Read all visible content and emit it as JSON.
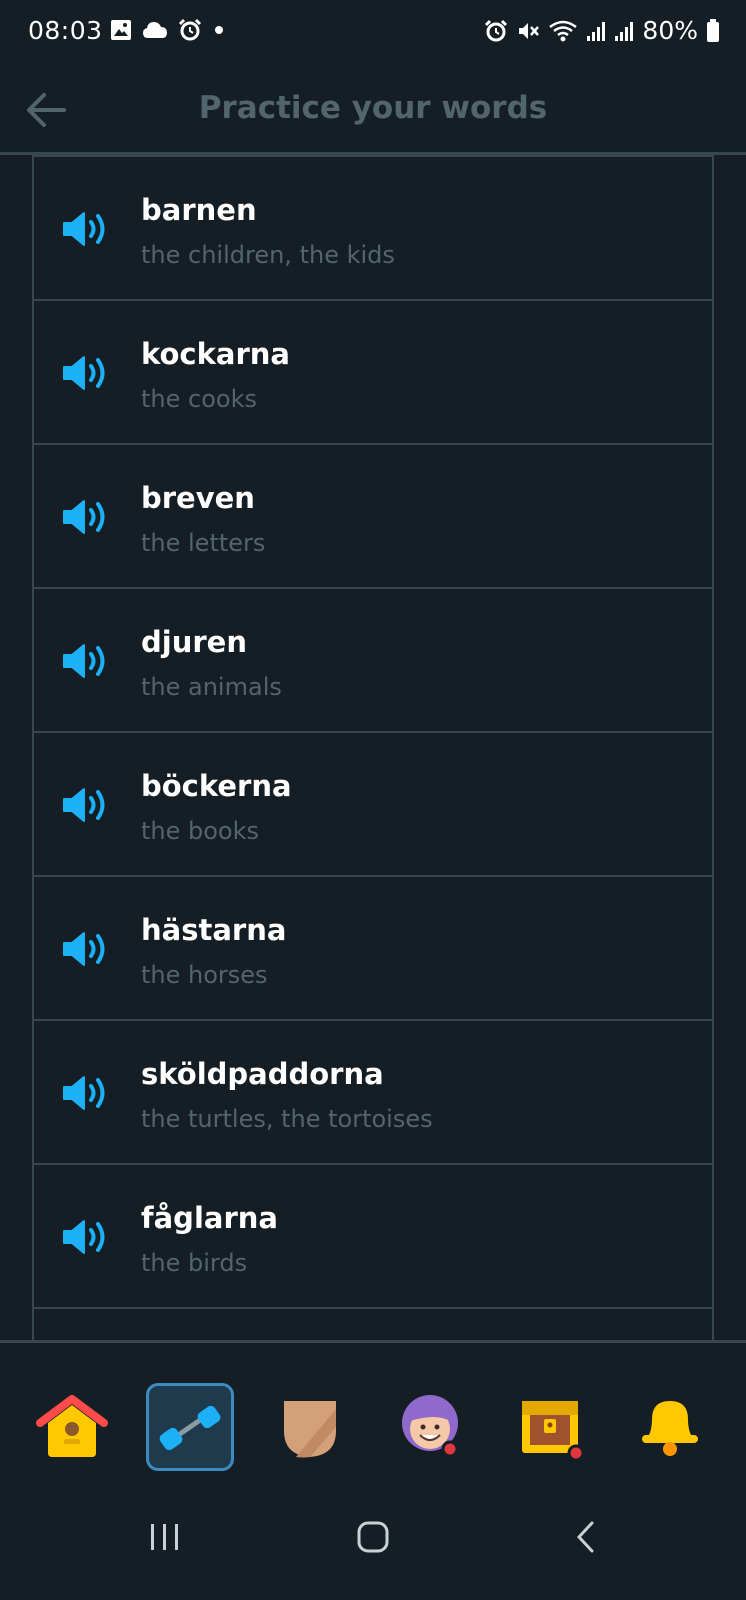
{
  "status_bar": {
    "time": "08:03",
    "battery": "80%",
    "left_icons": [
      "gallery-icon",
      "cloud-icon",
      "alarm-icon",
      "dot-icon"
    ],
    "right_icons": [
      "alarm-icon",
      "mute-icon",
      "wifi-icon",
      "signal-icon",
      "signal-icon",
      "battery-icon"
    ]
  },
  "header": {
    "title": "Practice your words",
    "back_icon": "arrow-left-icon"
  },
  "words": [
    {
      "word": "barnen",
      "translation": "the children, the kids"
    },
    {
      "word": "kockarna",
      "translation": "the cooks"
    },
    {
      "word": "breven",
      "translation": "the letters"
    },
    {
      "word": "djuren",
      "translation": "the animals"
    },
    {
      "word": "böckerna",
      "translation": "the books"
    },
    {
      "word": "hästarna",
      "translation": "the horses"
    },
    {
      "word": "sköldpaddorna",
      "translation": "the turtles, the tortoises"
    },
    {
      "word": "fåglarna",
      "translation": "the birds"
    }
  ],
  "tabs": [
    {
      "icon": "home-icon",
      "active": false
    },
    {
      "icon": "practice-dumbbell-icon",
      "active": true
    },
    {
      "icon": "league-shield-icon",
      "active": false
    },
    {
      "icon": "profile-avatar-icon",
      "active": false
    },
    {
      "icon": "treasure-chest-icon",
      "active": false
    },
    {
      "icon": "bell-icon",
      "active": false
    }
  ],
  "colors": {
    "background": "#151e24",
    "border": "#37464f",
    "muted_text": "#52656d",
    "accent_blue": "#1cb0f6"
  }
}
